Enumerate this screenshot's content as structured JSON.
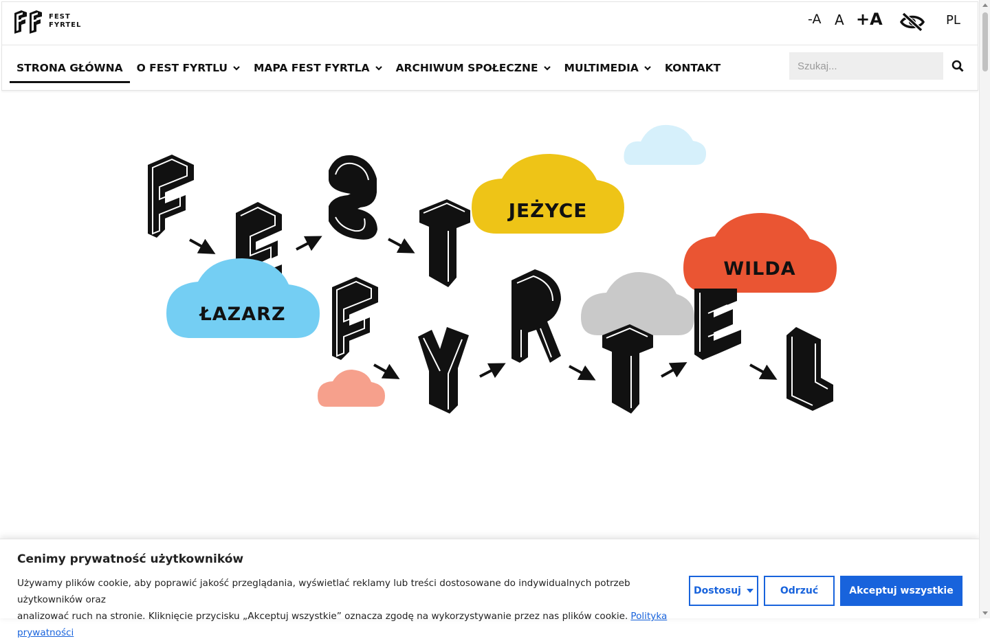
{
  "header": {
    "logo_line1": "FEST",
    "logo_line2": "FYRTEL",
    "font_decrease": "-A",
    "font_reset": "A",
    "font_increase": "+A",
    "language": "PL"
  },
  "nav": {
    "items": [
      {
        "label": "STRONA GŁÓWNA",
        "dropdown": false,
        "active": true
      },
      {
        "label": "O FEST FYRTLU",
        "dropdown": true
      },
      {
        "label": "MAPA FEST FYRTLA",
        "dropdown": true
      },
      {
        "label": "ARCHIWUM SPOŁECZNE",
        "dropdown": true
      },
      {
        "label": "MULTIMEDIA",
        "dropdown": true
      },
      {
        "label": "KONTAKT",
        "dropdown": false
      }
    ],
    "search_placeholder": "Szukaj..."
  },
  "hero": {
    "clouds": {
      "jezyce": "JEŻYCE",
      "wilda": "WILDA",
      "lazarz": "ŁAZARZ"
    },
    "colors": {
      "jezyce": "#eec417",
      "wilda": "#ea5533",
      "lazarz": "#74cef3",
      "light_blue": "#d6f0fb",
      "grey": "#c9c9c9",
      "salmon": "#f6a08c"
    }
  },
  "cookie": {
    "title": "Cenimy prywatność użytkowników",
    "text_line1": "Używamy plików cookie, aby poprawić jakość przeglądania, wyświetlać reklamy lub treści dostosowane do indywidualnych potrzeb użytkowników oraz",
    "text_line2": "analizować ruch na stronie. Kliknięcie przycisku „Akceptuj wszystkie” oznacza zgodę na wykorzystywanie przez nas plików cookie.",
    "policy_link": "Polityka prywatności",
    "customize": "Dostosuj",
    "reject": "Odrzuć",
    "accept": "Akceptuj wszystkie",
    "accent": "#1863dc"
  }
}
